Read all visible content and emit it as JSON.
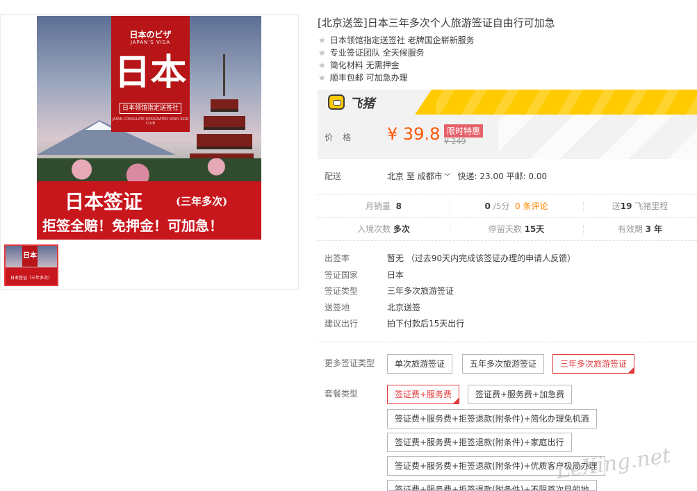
{
  "gallery": {
    "poster": {
      "top_text": "日本のビザ",
      "top_sub": "JAPAN'S VISA",
      "big_text": "日本",
      "stamp_text": "日本领馆指定送签社",
      "tiny_text": "JAPAN CONSULATE DESIGNATED SEND SIGN CLUB",
      "bottom_main": "日本签证",
      "bottom_sub": "(三年多次)",
      "bottom_slogan": "拒签全赔！免押金！可加急！"
    },
    "thumb_text": "日本",
    "thumb_sub": "日本签证（三年多次）"
  },
  "product": {
    "title": "[北京送签]日本三年多次个人旅游签证自由行可加急",
    "bullets": [
      "日本领馆指定送签社 老牌国企崭新服务",
      "专业签证团队 全天候服务",
      "简化材料 无需押金",
      "顺丰包邮 可加急办理"
    ]
  },
  "brand": {
    "name": "飞猪",
    "color": "#ffcb00"
  },
  "price": {
    "label": "价格",
    "current": "¥ 39.8",
    "promo_badge": "限时特惠",
    "original": "¥ 249",
    "color": "#ff5500"
  },
  "delivery": {
    "label": "配送",
    "from": "北京",
    "to_word": "至",
    "city": "成都市",
    "express": "快递: 23.00",
    "mail": "平邮: 0.00"
  },
  "stats": {
    "monthly_sales_label": "月销量",
    "monthly_sales": "8",
    "rating": "0",
    "rating_suffix": "/5分",
    "reviews": "0 条评论",
    "points_prefix": "送",
    "points": "19",
    "points_suffix": "飞猪里程",
    "entries_label": "入境次数",
    "entries": "多次",
    "stay_label": "停留天数",
    "stay": "15天",
    "validity_label": "有效期",
    "validity": "3 年"
  },
  "attributes": [
    {
      "key": "出签率",
      "value": "暂无 （过去90天内完成该签证办理的申请人反馈）"
    },
    {
      "key": "签证国家",
      "value": "日本"
    },
    {
      "key": "签证类型",
      "value": "三年多次旅游签证"
    },
    {
      "key": "送签地",
      "value": "北京送签"
    },
    {
      "key": "建议出行",
      "value": "拍下付款后15天出行"
    }
  ],
  "visa_types": {
    "label": "更多签证类型",
    "options": [
      "单次旅游签证",
      "五年多次旅游签证",
      "三年多次旅游签证"
    ],
    "selected": "三年多次旅游签证"
  },
  "packages": {
    "label": "套餐类型",
    "options": [
      "签证费+服务费",
      "签证费+服务费+加急费",
      "签证费+服务费+拒签退款(附条件)+简化办理免机酒",
      "签证费+服务费+拒签退款(附条件)+家庭出行",
      "签证费+服务费+拒签退款(附条件)+优质客户极简办理",
      "签证费+服务费+拒签退款(附条件)+不限首次目的地"
    ],
    "selected": "签证费+服务费"
  },
  "watermark": "LeXing.net"
}
